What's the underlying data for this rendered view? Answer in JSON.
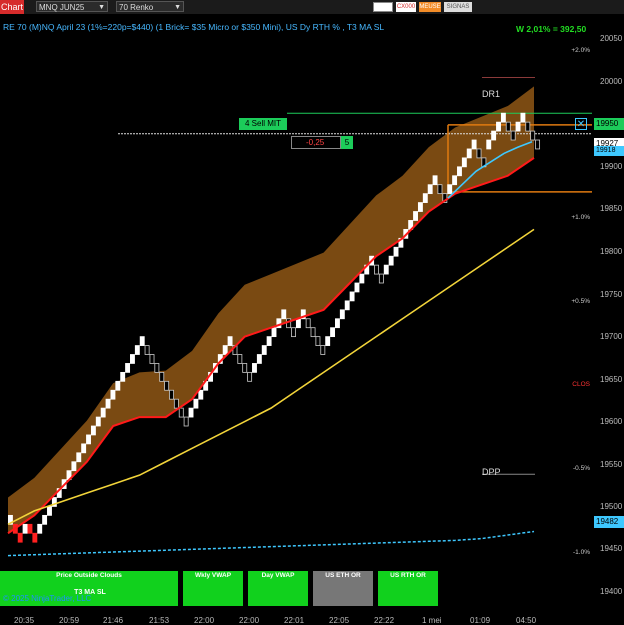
{
  "toolbar": {
    "chart_tab": "Chart",
    "instrument": "MNQ JUN25",
    "bar_type": "70 Renko",
    "buttons": [
      {
        "label": "",
        "color": "#ffffff",
        "text_color": "#000000"
      },
      {
        "label": "CX000",
        "color": "#ffffff",
        "text_color": "#d62b2b"
      },
      {
        "label": "MEUSE",
        "color": "#f28c28",
        "text_color": "#ffffff"
      },
      {
        "label": "SIGNAS",
        "color": "#dddddd",
        "text_color": "#555555"
      }
    ]
  },
  "chart": {
    "title": "RE 70 (M)NQ April 23 (1%=220p=$440) (1 Brick= $35 Micro or $350 Mini), US Dy RTH % , T3 MA SL",
    "pnl": "W 2,01% = 392,50",
    "price_axis": [
      "20050",
      "20000",
      "19950",
      "19900",
      "19850",
      "19800",
      "19750",
      "19700",
      "19650",
      "19600",
      "19550",
      "19500",
      "19450",
      "19400"
    ],
    "time_axis": [
      "20:35",
      "20:59",
      "21:46",
      "21:53",
      "22:00",
      "22:00",
      "22:01",
      "22:05",
      "22:22",
      "1 mei",
      "01:09",
      "04:50"
    ],
    "percent_labels": [
      {
        "label": "+2.0%",
        "color": "#cccccc"
      },
      {
        "label": "+1.0%",
        "color": "#cccccc"
      },
      {
        "label": "+0.5%",
        "color": "#cccccc"
      },
      {
        "label": "CLOS",
        "color": "#ff3333"
      },
      {
        "label": "-0.5%",
        "color": "#cccccc"
      },
      {
        "label": "-1.0%",
        "color": "#cccccc"
      }
    ],
    "levels": {
      "dr1": "DR1",
      "dpp": "DPP"
    },
    "order": {
      "label": "4 Sell MIT",
      "price_tag": "19950"
    },
    "position": {
      "pnl": "-0,25",
      "qty": "5",
      "price_tag": "19927",
      "sub_tag": "19918"
    },
    "vwap_tag": "19482"
  },
  "chart_data": {
    "type": "renko",
    "brick_size": 10,
    "bricks": [
      {
        "o": 19490,
        "c": 19500
      },
      {
        "o": 19490,
        "c": 19480
      },
      {
        "o": 19480,
        "c": 19470
      },
      {
        "o": 19480,
        "c": 19490
      },
      {
        "o": 19490,
        "c": 19480
      },
      {
        "o": 19480,
        "c": 19470
      },
      {
        "o": 19480,
        "c": 19490
      },
      {
        "o": 19490,
        "c": 19500
      },
      {
        "o": 19500,
        "c": 19510
      },
      {
        "o": 19510,
        "c": 19520
      },
      {
        "o": 19520,
        "c": 19530
      },
      {
        "o": 19530,
        "c": 19540
      },
      {
        "o": 19540,
        "c": 19550
      },
      {
        "o": 19550,
        "c": 19560
      },
      {
        "o": 19560,
        "c": 19570
      },
      {
        "o": 19570,
        "c": 19580
      },
      {
        "o": 19580,
        "c": 19590
      },
      {
        "o": 19590,
        "c": 19600
      },
      {
        "o": 19600,
        "c": 19610
      },
      {
        "o": 19610,
        "c": 19620
      },
      {
        "o": 19620,
        "c": 19630
      },
      {
        "o": 19630,
        "c": 19640
      },
      {
        "o": 19640,
        "c": 19650
      },
      {
        "o": 19650,
        "c": 19660
      },
      {
        "o": 19660,
        "c": 19670
      },
      {
        "o": 19670,
        "c": 19680
      },
      {
        "o": 19680,
        "c": 19690
      },
      {
        "o": 19690,
        "c": 19700
      },
      {
        "o": 19690,
        "c": 19680
      },
      {
        "o": 19680,
        "c": 19670
      },
      {
        "o": 19670,
        "c": 19660
      },
      {
        "o": 19660,
        "c": 19650
      },
      {
        "o": 19650,
        "c": 19640
      },
      {
        "o": 19640,
        "c": 19630
      },
      {
        "o": 19630,
        "c": 19620
      },
      {
        "o": 19620,
        "c": 19610
      },
      {
        "o": 19610,
        "c": 19600
      },
      {
        "o": 19610,
        "c": 19620
      },
      {
        "o": 19620,
        "c": 19630
      },
      {
        "o": 19630,
        "c": 19640
      },
      {
        "o": 19640,
        "c": 19650
      },
      {
        "o": 19650,
        "c": 19660
      },
      {
        "o": 19660,
        "c": 19670
      },
      {
        "o": 19670,
        "c": 19680
      },
      {
        "o": 19680,
        "c": 19690
      },
      {
        "o": 19690,
        "c": 19700
      },
      {
        "o": 19690,
        "c": 19680
      },
      {
        "o": 19680,
        "c": 19670
      },
      {
        "o": 19670,
        "c": 19660
      },
      {
        "o": 19660,
        "c": 19650
      },
      {
        "o": 19660,
        "c": 19670
      },
      {
        "o": 19670,
        "c": 19680
      },
      {
        "o": 19680,
        "c": 19690
      },
      {
        "o": 19690,
        "c": 19700
      },
      {
        "o": 19700,
        "c": 19710
      },
      {
        "o": 19710,
        "c": 19720
      },
      {
        "o": 19720,
        "c": 19730
      },
      {
        "o": 19720,
        "c": 19710
      },
      {
        "o": 19710,
        "c": 19700
      },
      {
        "o": 19710,
        "c": 19720
      },
      {
        "o": 19720,
        "c": 19730
      },
      {
        "o": 19720,
        "c": 19710
      },
      {
        "o": 19710,
        "c": 19700
      },
      {
        "o": 19700,
        "c": 19690
      },
      {
        "o": 19690,
        "c": 19680
      },
      {
        "o": 19690,
        "c": 19700
      },
      {
        "o": 19700,
        "c": 19710
      },
      {
        "o": 19710,
        "c": 19720
      },
      {
        "o": 19720,
        "c": 19730
      },
      {
        "o": 19730,
        "c": 19740
      },
      {
        "o": 19740,
        "c": 19750
      },
      {
        "o": 19750,
        "c": 19760
      },
      {
        "o": 19760,
        "c": 19770
      },
      {
        "o": 19770,
        "c": 19780
      },
      {
        "o": 19780,
        "c": 19790
      },
      {
        "o": 19780,
        "c": 19770
      },
      {
        "o": 19770,
        "c": 19760
      },
      {
        "o": 19770,
        "c": 19780
      },
      {
        "o": 19780,
        "c": 19790
      },
      {
        "o": 19790,
        "c": 19800
      },
      {
        "o": 19800,
        "c": 19810
      },
      {
        "o": 19810,
        "c": 19820
      },
      {
        "o": 19820,
        "c": 19830
      },
      {
        "o": 19830,
        "c": 19840
      },
      {
        "o": 19840,
        "c": 19850
      },
      {
        "o": 19850,
        "c": 19860
      },
      {
        "o": 19860,
        "c": 19870
      },
      {
        "o": 19870,
        "c": 19880
      },
      {
        "o": 19870,
        "c": 19860
      },
      {
        "o": 19860,
        "c": 19850
      },
      {
        "o": 19860,
        "c": 19870
      },
      {
        "o": 19870,
        "c": 19880
      },
      {
        "o": 19880,
        "c": 19890
      },
      {
        "o": 19890,
        "c": 19900
      },
      {
        "o": 19900,
        "c": 19910
      },
      {
        "o": 19910,
        "c": 19920
      },
      {
        "o": 19910,
        "c": 19900
      },
      {
        "o": 19900,
        "c": 19890
      },
      {
        "o": 19910,
        "c": 19920
      },
      {
        "o": 19920,
        "c": 19930
      },
      {
        "o": 19930,
        "c": 19940
      },
      {
        "o": 19940,
        "c": 19950
      },
      {
        "o": 19940,
        "c": 19930
      },
      {
        "o": 19930,
        "c": 19920
      },
      {
        "o": 19930,
        "c": 19940
      },
      {
        "o": 19940,
        "c": 19950
      },
      {
        "o": 19940,
        "c": 19930
      },
      {
        "o": 19930,
        "c": 19920
      },
      {
        "o": 19920,
        "c": 19910
      }
    ],
    "t3_ma": [
      19490,
      19505,
      19515,
      19525,
      19535,
      19545,
      19560,
      19575,
      19590,
      19605,
      19620,
      19640,
      19660,
      19680,
      19700,
      19720,
      19740,
      19760,
      19780,
      19800,
      19820
    ],
    "stop_line": [
      19480,
      19500,
      19530,
      19560,
      19600,
      19610,
      19610,
      19630,
      19670,
      19700,
      19710,
      19720,
      19730,
      19760,
      19790,
      19810,
      19840,
      19860,
      19870,
      19880,
      19900
    ],
    "vwap": [
      19455,
      19456,
      19457,
      19458,
      19459,
      19460,
      19461,
      19462,
      19463,
      19464,
      19465,
      19466,
      19467,
      19468,
      19469,
      19470,
      19471,
      19472,
      19474,
      19478,
      19482
    ],
    "ylim": [
      19393,
      20061
    ]
  },
  "panel": {
    "buttons": [
      {
        "label": "Price Outside Clouds",
        "color": "#11d11d"
      },
      {
        "label": "Wkly VWAP",
        "color": "#11d11d"
      },
      {
        "label": "Day VWAP",
        "color": "#11d11d"
      },
      {
        "label": "US ETH OR",
        "color": "#777777"
      },
      {
        "label": "US RTH OR",
        "color": "#11d11d"
      }
    ],
    "t3_label": "T3 MA SL",
    "copyright": "© 2025 NinjaTrader, LLC"
  }
}
